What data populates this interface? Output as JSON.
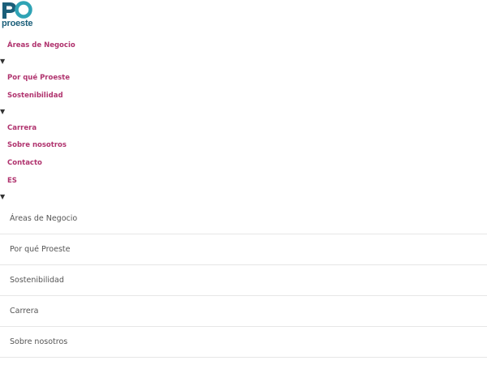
{
  "brand": {
    "logo_text": "proeste",
    "colors": {
      "primary": "#1b5f7a",
      "secondary": "#2fa3b5",
      "link": "#b0336e"
    }
  },
  "nav": {
    "items": [
      {
        "label": "Áreas de Negocio"
      },
      {
        "label": "Por qué Proeste"
      },
      {
        "label": "Sostenibilidad"
      },
      {
        "label": "Carrera"
      },
      {
        "label": "Sobre nosotros"
      },
      {
        "label": "Contacto"
      },
      {
        "label": "ES"
      }
    ],
    "caret": "▼"
  },
  "menu": {
    "items": [
      {
        "label": "Áreas de Negocio"
      },
      {
        "label": "Por qué Proeste"
      },
      {
        "label": "Sostenibilidad"
      },
      {
        "label": "Carrera"
      },
      {
        "label": "Sobre nosotros"
      }
    ]
  }
}
